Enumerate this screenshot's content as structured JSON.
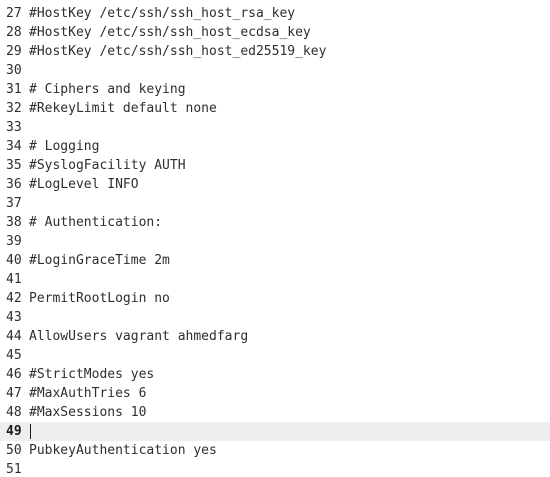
{
  "editor": {
    "current_line": "49",
    "lines": [
      {
        "num": "27",
        "text": "#HostKey /etc/ssh/ssh_host_rsa_key"
      },
      {
        "num": "28",
        "text": "#HostKey /etc/ssh/ssh_host_ecdsa_key"
      },
      {
        "num": "29",
        "text": "#HostKey /etc/ssh/ssh_host_ed25519_key"
      },
      {
        "num": "30",
        "text": ""
      },
      {
        "num": "31",
        "text": "# Ciphers and keying"
      },
      {
        "num": "32",
        "text": "#RekeyLimit default none"
      },
      {
        "num": "33",
        "text": ""
      },
      {
        "num": "34",
        "text": "# Logging"
      },
      {
        "num": "35",
        "text": "#SyslogFacility AUTH"
      },
      {
        "num": "36",
        "text": "#LogLevel INFO"
      },
      {
        "num": "37",
        "text": ""
      },
      {
        "num": "38",
        "text": "# Authentication:"
      },
      {
        "num": "39",
        "text": ""
      },
      {
        "num": "40",
        "text": "#LoginGraceTime 2m"
      },
      {
        "num": "41",
        "text": ""
      },
      {
        "num": "42",
        "text": "PermitRootLogin no"
      },
      {
        "num": "43",
        "text": ""
      },
      {
        "num": "44",
        "text": "AllowUsers vagrant ahmedfarg"
      },
      {
        "num": "45",
        "text": ""
      },
      {
        "num": "46",
        "text": "#StrictModes yes"
      },
      {
        "num": "47",
        "text": "#MaxAuthTries 6"
      },
      {
        "num": "48",
        "text": "#MaxSessions 10"
      },
      {
        "num": "49",
        "text": ""
      },
      {
        "num": "50",
        "text": "PubkeyAuthentication yes"
      },
      {
        "num": "51",
        "text": ""
      }
    ]
  }
}
